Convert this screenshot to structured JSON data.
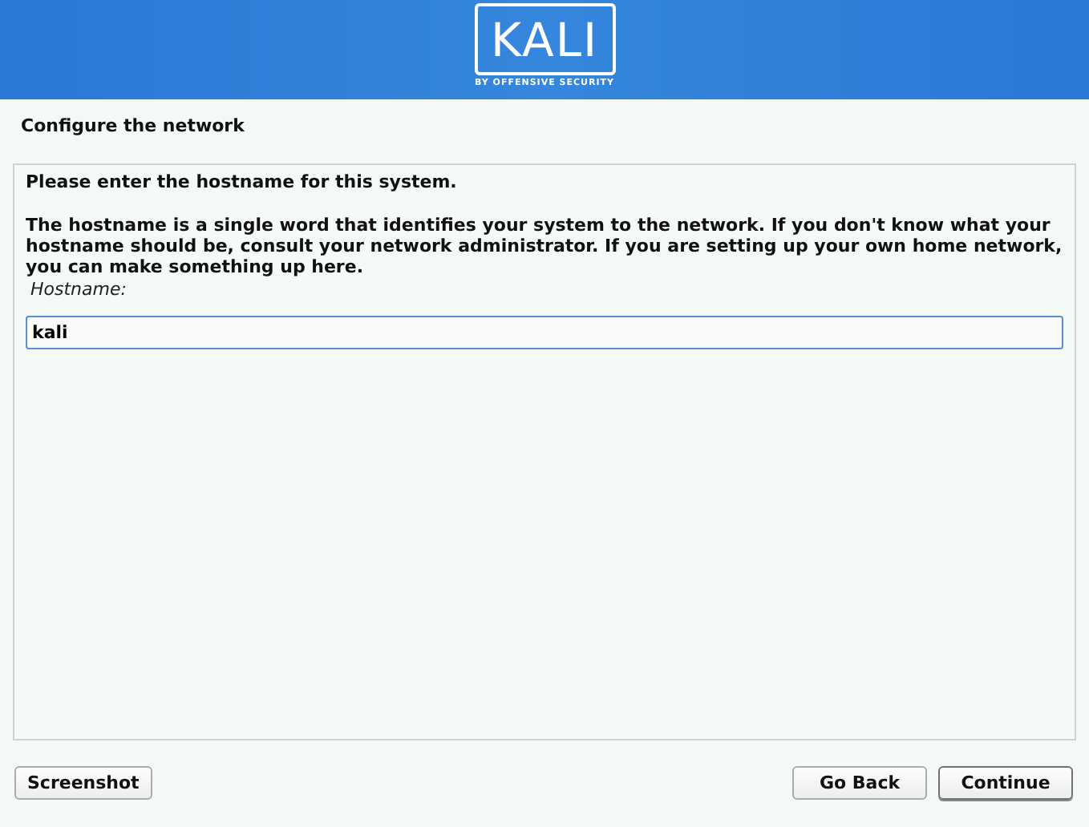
{
  "banner": {
    "logo_text": "KALI",
    "tagline": "BY OFFENSIVE SECURITY"
  },
  "title": "Configure the network",
  "panel": {
    "heading": "Please enter the hostname for this system.",
    "description": "The hostname is a single word that identifies your system to the network. If you don't know what your hostname should be, consult your network administrator. If you are setting up your own home network, you can make something up here.",
    "field_label": "Hostname:",
    "field_value": "kali"
  },
  "buttons": [
    {
      "label": "Screenshot",
      "default": false
    },
    {
      "label": "Go Back",
      "default": false
    },
    {
      "label": "Continue",
      "default": true
    }
  ]
}
